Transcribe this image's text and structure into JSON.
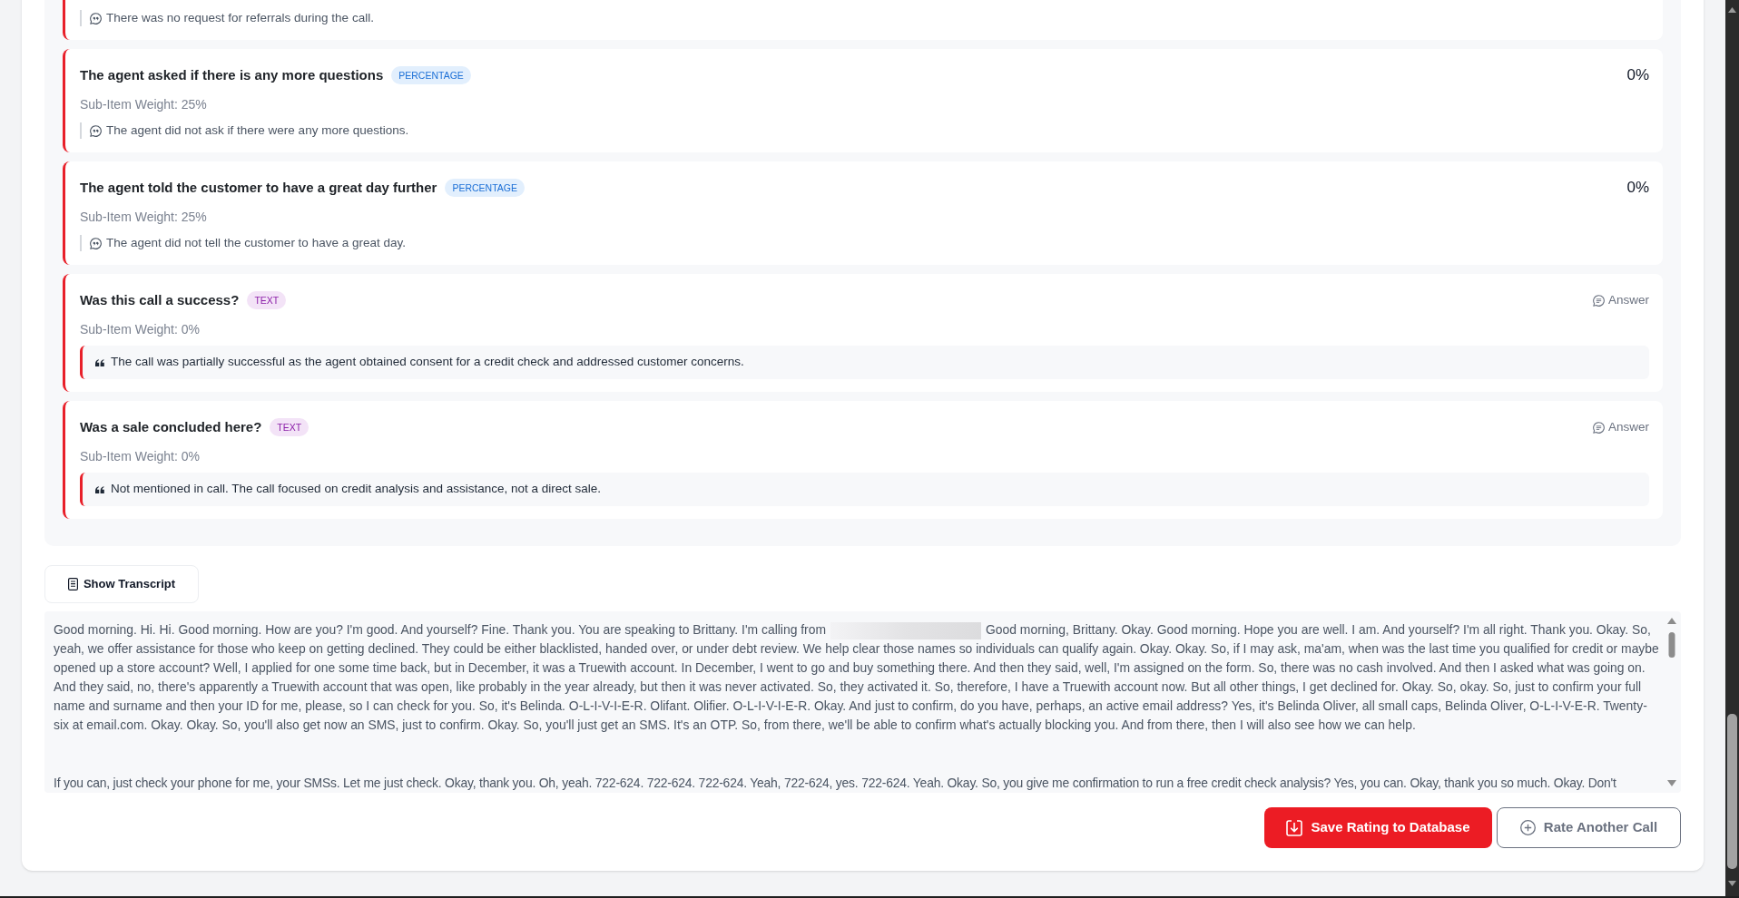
{
  "evaluation_items": [
    {
      "kind": "percentage",
      "comment": "There was no request for referrals during the call."
    },
    {
      "kind": "percentage",
      "title": "The agent asked if there is any more questions",
      "badge": "PERCENTAGE",
      "score": "0%",
      "weight": "Sub-Item Weight: 25%",
      "comment": "The agent did not ask if there were any more questions."
    },
    {
      "kind": "percentage",
      "title": "The agent told the customer to have a great day further",
      "badge": "PERCENTAGE",
      "score": "0%",
      "weight": "Sub-Item Weight: 25%",
      "comment": "The agent did not tell the customer to have a great day."
    },
    {
      "kind": "text",
      "title": "Was this call a success?",
      "badge": "TEXT",
      "answer_label": "Answer",
      "weight": "Sub-Item Weight: 0%",
      "answer": "The call was partially successful as the agent obtained consent for a credit check and addressed customer concerns."
    },
    {
      "kind": "text",
      "title": "Was a sale concluded here?",
      "badge": "TEXT",
      "answer_label": "Answer",
      "weight": "Sub-Item Weight: 0%",
      "answer": "Not mentioned in call. The call focused on credit analysis and assistance, not a direct sale."
    }
  ],
  "transcript_button": "Show Transcript",
  "transcript": {
    "paragraphs": [
      {
        "segments": [
          {
            "kind": "text",
            "text": "Good morning. Hi. Hi. Good morning. How are you? I'm good. And yourself? Fine. Thank you. You are speaking to Brittany. I'm calling from"
          },
          {
            "kind": "redacted"
          },
          {
            "kind": "text",
            "text": "Good morning, Brittany. Okay. Good morning. Hope you are well. I am. And yourself? I'm all right. Thank you. Okay. So, yeah, we offer assistance for those who keep on getting declined. They could be either blacklisted, handed over, or under debt review. We help clear those names so individuals can qualify again. Okay. Okay. So, if I may ask, ma'am, when was the last time you qualified for credit or maybe opened up a store account? Well, I applied for one some time back, but in December, it was a Truewith account. In December, I went to go and buy something there. And then they said, well, I'm assigned on the form. So, there was no cash involved. And then I asked what was going on. And they said, no, there's apparently a Truewith account that was open, like probably in the year already, but then it was never activated. So, they activated it. So, therefore, I have a Truewith account now. But all other things, I get declined for. Okay. So, okay. So, just to confirm your full name and surname and then your ID for me, please, so I can check for you. So, it's Belinda. O-L-I-V-I-E-R. Olifant. Olifier. O-L-I-V-I-E-R. Okay. And just to confirm, do you have, perhaps, an active email address? Yes, it's Belinda Oliver, all small caps, Belinda Oliver, O-L-I-V-E-R. Twenty-six at email.com. Okay. Okay. So, you'll also get now an SMS, just to confirm. Okay. So, you'll just get an SMS. It's an OTP. So, from there, we'll be able to confirm what's actually blocking you. And from there, then I will also see how we can help."
          }
        ]
      },
      {
        "segments": [
          {
            "kind": "text",
            "text": "If you can, just check your phone for me, your SMSs. Let me just check. Okay, thank you. Oh, yeah. 722-624. 722-624. 722-624. Yeah, 722-624, yes. 722-624. Yeah. Okay. So, you give me confirmation to run a free credit check analysis? Yes, you can. Okay, thank you so much. Okay. Don't"
          }
        ]
      }
    ]
  },
  "actions": [
    {
      "kind": "primary",
      "label": "Save Rating to Database"
    },
    {
      "kind": "secondary",
      "label": "Rate Another Call"
    }
  ]
}
